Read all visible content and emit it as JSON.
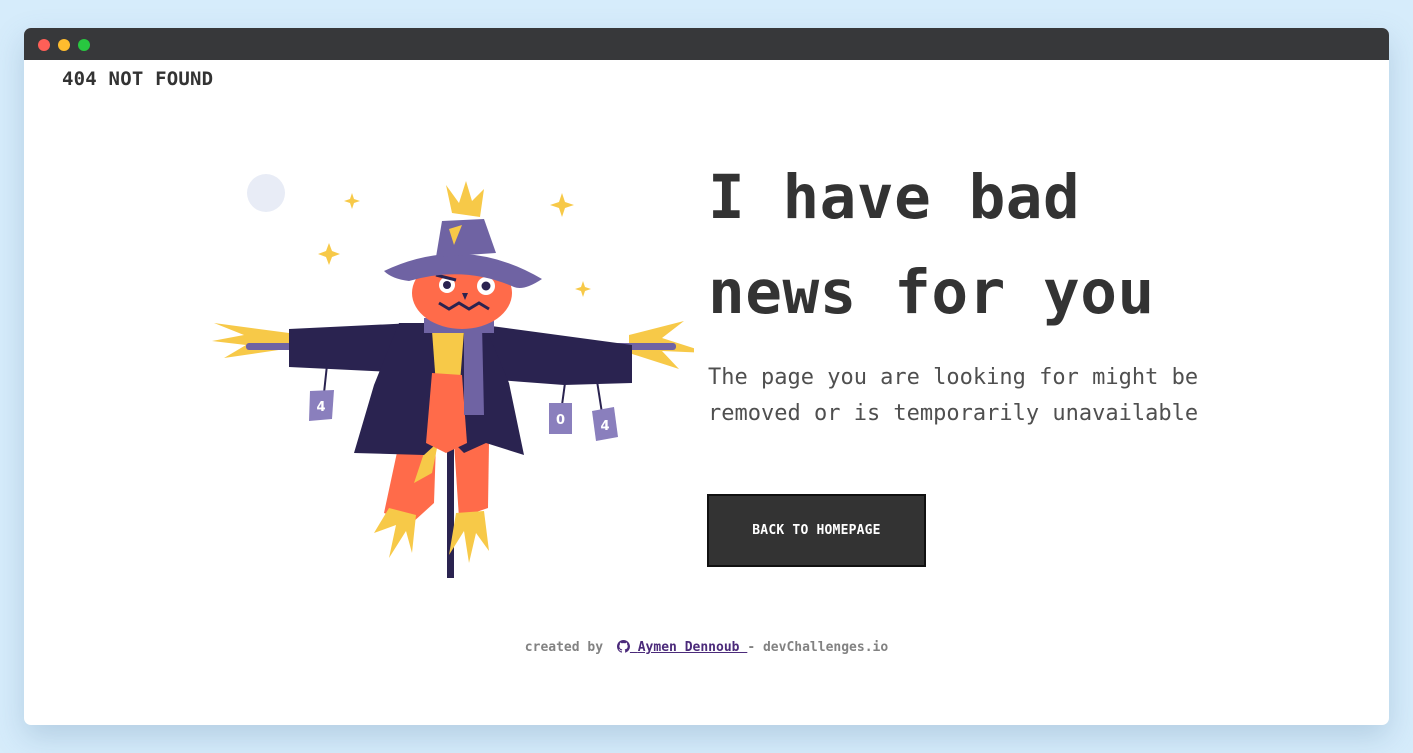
{
  "window": {
    "controls": [
      "close",
      "minimize",
      "maximize"
    ],
    "colors": {
      "close": "#fe5f57",
      "minimize": "#febc2e",
      "maximize": "#28c840"
    }
  },
  "brand": {
    "text": "404 NOT FOUND"
  },
  "illustration": {
    "description_icon": "scarecrow-illustration",
    "cans": [
      "4",
      "0",
      "4"
    ]
  },
  "main": {
    "headline_line1": "I have bad",
    "headline_line2": "news for you",
    "subtext_line1": "The page you are looking for might be",
    "subtext_line2": "removed or is temporarily unavailable",
    "button_label": "BACK TO HOMEPAGE"
  },
  "footer": {
    "prefix": "created by",
    "author": "Aymen Dennoub",
    "separator": "-",
    "site": "devChallenges.io"
  },
  "colors": {
    "page_bg": "#d6ecfb",
    "text": "#333333",
    "button_bg": "#333333",
    "link": "#4b2a7a"
  }
}
